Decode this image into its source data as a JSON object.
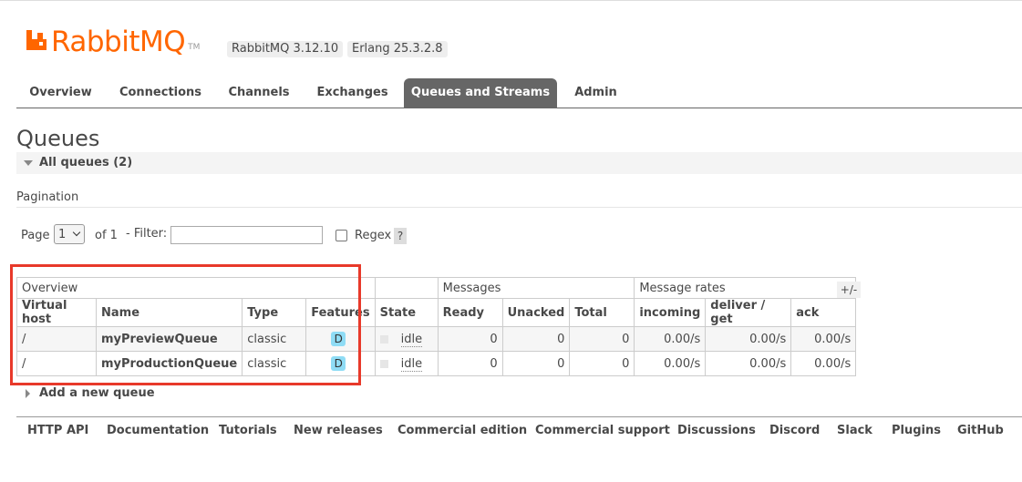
{
  "app": {
    "logo_text": "RabbitMQ",
    "logo_tm": "TM",
    "rabbitmq_version": "RabbitMQ 3.12.10",
    "erlang_version": "Erlang 25.3.2.8",
    "brand_color": "#ff6600"
  },
  "nav": {
    "items": [
      "Overview",
      "Connections",
      "Channels",
      "Exchanges",
      "Queues and Streams",
      "Admin"
    ],
    "active": "Queues and Streams"
  },
  "page": {
    "title": "Queues",
    "section_title": "All queues (2)",
    "pagination_title": "Pagination"
  },
  "filters": {
    "page_label": "Page",
    "page_value": "1",
    "of_label": "of 1",
    "filter_label": "- Filter:",
    "filter_value": "",
    "regex_label": "Regex",
    "regex_checked": false,
    "help_label": "?"
  },
  "table": {
    "group_headers": [
      "Overview",
      "Messages",
      "Message rates"
    ],
    "columns": [
      "Virtual host",
      "Name",
      "Type",
      "Features",
      "State",
      "Ready",
      "Unacked",
      "Total",
      "incoming",
      "deliver / get",
      "ack"
    ],
    "toggle_label": "+/-",
    "rows": [
      {
        "vhost": "/",
        "name": "myPreviewQueue",
        "type": "classic",
        "feature": "D",
        "state": "idle",
        "ready": "0",
        "unacked": "0",
        "total": "0",
        "incoming": "0.00/s",
        "deliver_get": "0.00/s",
        "ack": "0.00/s"
      },
      {
        "vhost": "/",
        "name": "myProductionQueue",
        "type": "classic",
        "feature": "D",
        "state": "idle",
        "ready": "0",
        "unacked": "0",
        "total": "0",
        "incoming": "0.00/s",
        "deliver_get": "0.00/s",
        "ack": "0.00/s"
      }
    ]
  },
  "add_queue_label": "Add a new queue",
  "footer": {
    "links": [
      "HTTP API",
      "Documentation",
      "Tutorials",
      "New releases",
      "Commercial edition",
      "Commercial support",
      "Discussions",
      "Discord",
      "Slack",
      "Plugins",
      "GitHub"
    ]
  }
}
